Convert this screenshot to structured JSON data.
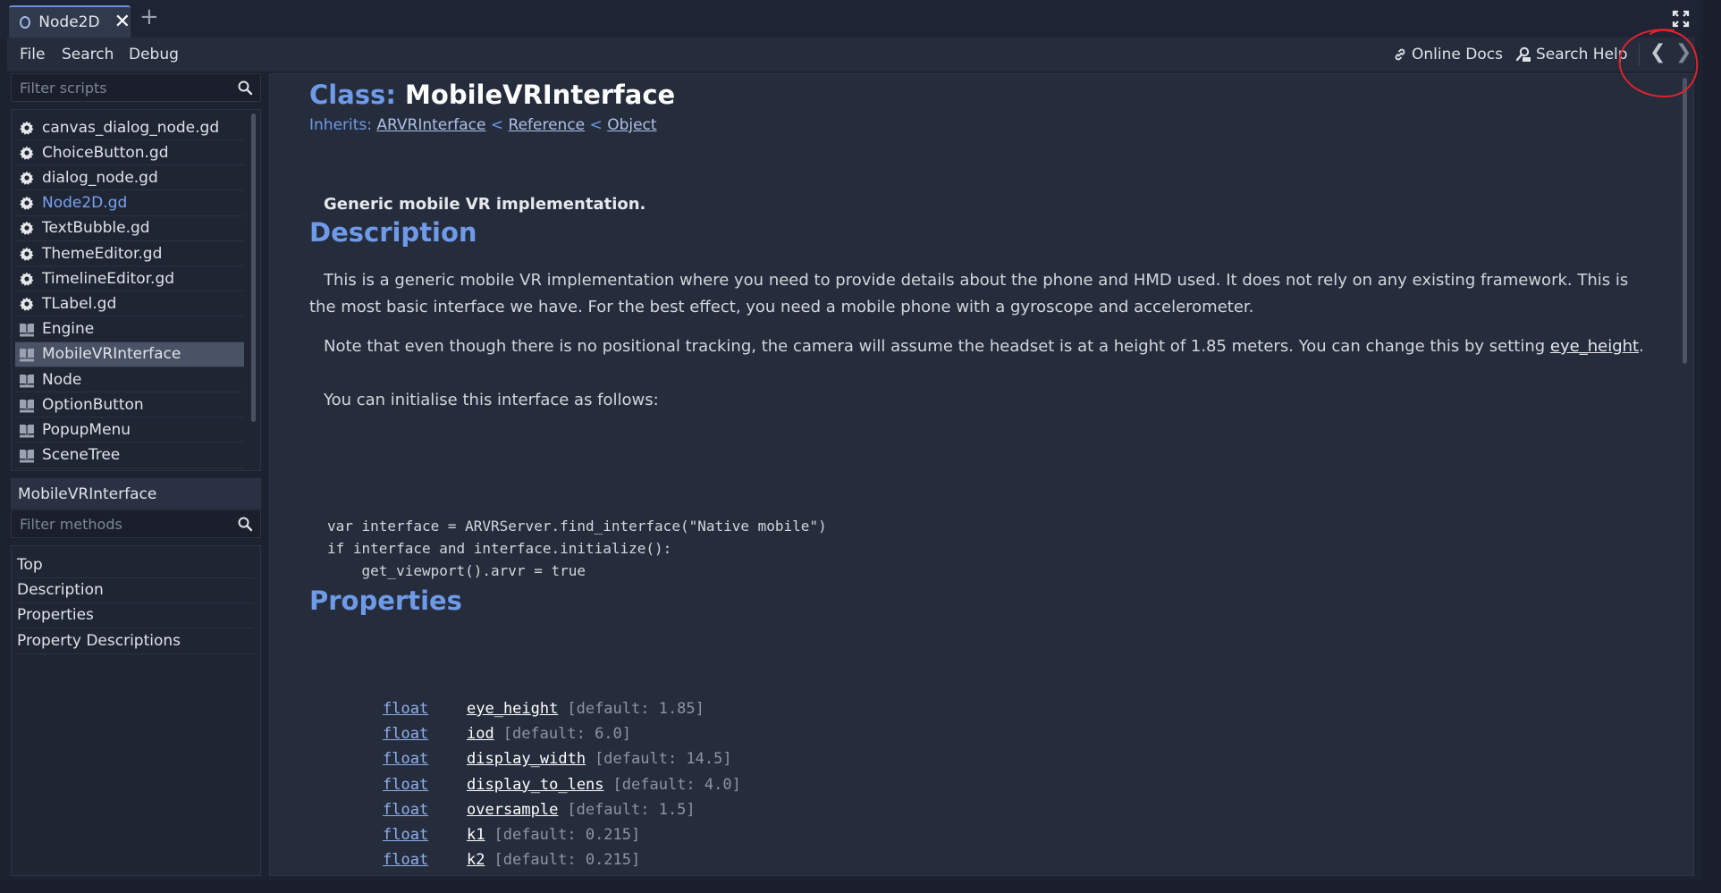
{
  "scene_tab": {
    "label": "Node2D"
  },
  "menu": {
    "file": "File",
    "search": "Search",
    "debug": "Debug",
    "online_docs": "Online Docs",
    "search_help": "Search Help",
    "back": "❮",
    "forward": "❯"
  },
  "scripts_filter": {
    "placeholder": "Filter scripts"
  },
  "scripts": [
    {
      "label": "canvas_dialog_node.gd",
      "icon": "gear-icon"
    },
    {
      "label": "ChoiceButton.gd",
      "icon": "gear-icon"
    },
    {
      "label": "dialog_node.gd",
      "icon": "gear-icon"
    },
    {
      "label": "Node2D.gd",
      "icon": "gear-icon",
      "active": true
    },
    {
      "label": "TextBubble.gd",
      "icon": "gear-icon"
    },
    {
      "label": "ThemeEditor.gd",
      "icon": "gear-icon"
    },
    {
      "label": "TimelineEditor.gd",
      "icon": "gear-icon"
    },
    {
      "label": "TLabel.gd",
      "icon": "gear-icon"
    },
    {
      "label": "Engine",
      "icon": "doc-icon"
    },
    {
      "label": "MobileVRInterface",
      "icon": "doc-icon",
      "selected": true
    },
    {
      "label": "Node",
      "icon": "doc-icon"
    },
    {
      "label": "OptionButton",
      "icon": "doc-icon"
    },
    {
      "label": "PopupMenu",
      "icon": "doc-icon"
    },
    {
      "label": "SceneTree",
      "icon": "doc-icon"
    }
  ],
  "class_panel": {
    "title": "MobileVRInterface"
  },
  "methods_filter": {
    "placeholder": "Filter methods"
  },
  "methods": [
    "Top",
    "Description",
    "Properties",
    "Property Descriptions"
  ],
  "doc": {
    "class_label": "Class:",
    "class_name": "MobileVRInterface",
    "inherits_label": "Inherits:",
    "inherits": [
      "ARVRInterface",
      "Reference",
      "Object"
    ],
    "inherits_sep": "<",
    "brief": "Generic mobile VR implementation.",
    "description_heading": "Description",
    "description_p1": "This is a generic mobile VR implementation where you need to provide details about the phone and HMD used. It does not rely on any existing framework. This is the most basic interface we have. For the best effect, you need a mobile phone with a gyroscope and accelerometer.",
    "description_p2_prefix": "Note that even though there is no positional tracking, the camera will assume the headset is at a height of 1.85 meters. You can change this by setting ",
    "description_p2_link": "eye_height",
    "description_p2_suffix": ".",
    "description_p3": "You can initialise this interface as follows:",
    "code": "var interface = ARVRServer.find_interface(\"Native mobile\")\nif interface and interface.initialize():\n    get_viewport().arvr = true",
    "properties_heading": "Properties",
    "properties": [
      {
        "type": "float",
        "name": "eye_height",
        "default": "[default: 1.85]"
      },
      {
        "type": "float",
        "name": "iod",
        "default": "[default: 6.0]"
      },
      {
        "type": "float",
        "name": "display_width",
        "default": "[default: 14.5]"
      },
      {
        "type": "float",
        "name": "display_to_lens",
        "default": "[default: 4.0]"
      },
      {
        "type": "float",
        "name": "oversample",
        "default": "[default: 1.5]"
      },
      {
        "type": "float",
        "name": "k1",
        "default": "[default: 0.215]"
      },
      {
        "type": "float",
        "name": "k2",
        "default": "[default: 0.215]"
      }
    ]
  },
  "colors": {
    "accent": "#6f9ae8",
    "annotation": "#e0232b",
    "selected_row": "#4a5366"
  }
}
